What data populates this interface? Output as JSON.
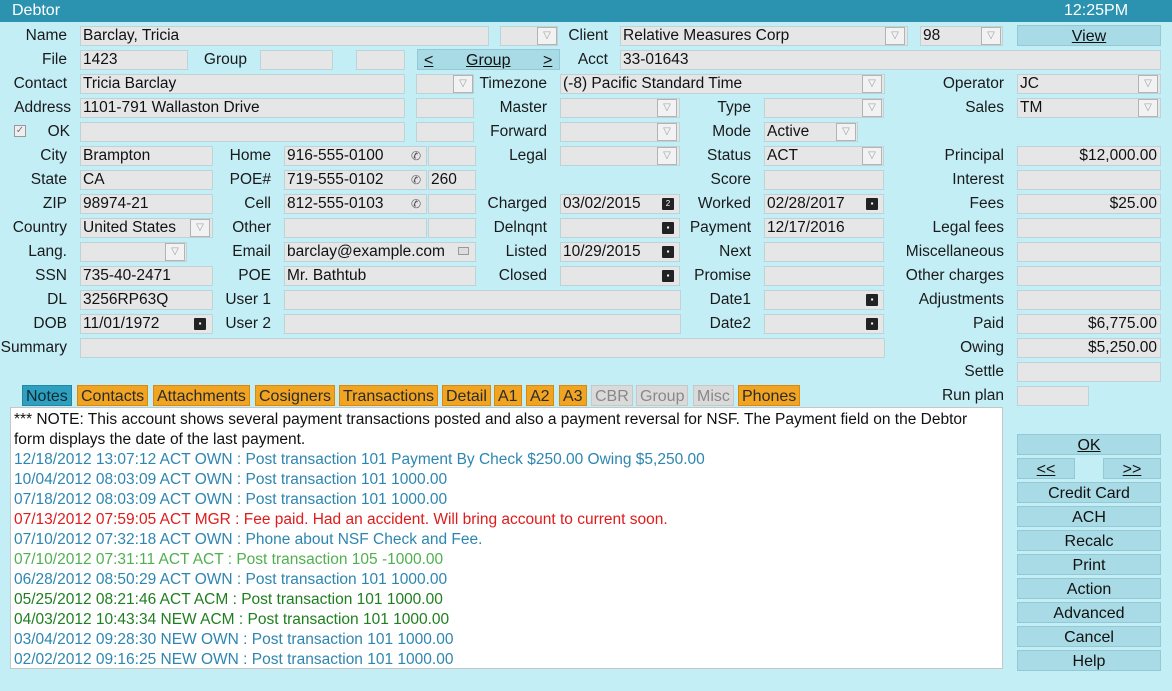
{
  "titlebar": {
    "title": "Debtor",
    "clock": "12:25PM"
  },
  "labels": {
    "name": "Name",
    "file": "File",
    "group": "Group",
    "contact": "Contact",
    "address": "Address",
    "ok": "OK",
    "city": "City",
    "state": "State",
    "zip": "ZIP",
    "country": "Country",
    "lang": "Lang.",
    "ssn": "SSN",
    "dl": "DL",
    "dob": "DOB",
    "summary": "Summary",
    "home": "Home",
    "poe_num": "POE#",
    "cell": "Cell",
    "other": "Other",
    "email": "Email",
    "poe": "POE",
    "user1": "User 1",
    "user2": "User 2",
    "client": "Client",
    "acct": "Acct",
    "timezone": "Timezone",
    "master": "Master",
    "forward": "Forward",
    "legal": "Legal",
    "charged": "Charged",
    "delnqnt": "Delnqnt",
    "listed": "Listed",
    "closed": "Closed",
    "type": "Type",
    "mode": "Mode",
    "status": "Status",
    "score": "Score",
    "worked": "Worked",
    "payment": "Payment",
    "next": "Next",
    "promise": "Promise",
    "date1": "Date1",
    "date2": "Date2",
    "operator": "Operator",
    "sales": "Sales",
    "principal": "Principal",
    "interest": "Interest",
    "fees": "Fees",
    "legal_fees": "Legal fees",
    "miscellaneous": "Miscellaneous",
    "other_charges": "Other charges",
    "adjustments": "Adjustments",
    "paid": "Paid",
    "owing": "Owing",
    "settle": "Settle",
    "run_plan": "Run plan"
  },
  "fields": {
    "name": "Barclay, Tricia",
    "file": "1423",
    "group": "",
    "contact": "Tricia Barclay",
    "address": "1101-791 Wallaston Drive",
    "city": "Brampton",
    "state": "CA",
    "zip": "98974-21",
    "country": "United States",
    "lang": "",
    "ssn": "735-40-2471",
    "dl": "3256RP63Q",
    "dob": "11/01/1972",
    "home": "916-555-0100",
    "poe_num": "719-555-0102",
    "poe_ext": "260",
    "cell": "812-555-0103",
    "other": "",
    "email": "barclay@example.com",
    "poe": "Mr. Bathtub",
    "user1": "",
    "user2": "",
    "summary": "",
    "client": "Relative Measures Corp",
    "client_code": "98",
    "acct": "33-01643",
    "timezone": "(-8) Pacific Standard Time",
    "charged": "03/02/2015",
    "listed": "10/29/2015",
    "mode": "Active",
    "status": "ACT",
    "worked": "02/28/2017",
    "payment": "12/17/2016",
    "operator": "JC",
    "sales": "TM",
    "principal": "$12,000.00",
    "fees": "$25.00",
    "paid": "$6,775.00",
    "owing": "$5,250.00"
  },
  "buttons": {
    "view": "View",
    "group_prev": "<",
    "group": "Group",
    "group_next": ">"
  },
  "tabs": [
    "Notes",
    "Contacts",
    "Attachments",
    "Cosigners",
    "Transactions",
    "Detail",
    "A1",
    "A2",
    "A3",
    "CBR",
    "Group",
    "Misc",
    "Phones"
  ],
  "notes": [
    {
      "text": "*** NOTE: This account shows several payment transactions posted and also a payment reversal for NSF. The Payment field on the Debtor",
      "color": "#111111"
    },
    {
      "text": "form displays the date of the last payment.",
      "color": "#111111"
    },
    {
      "text": "12/18/2012 13:07:12 ACT OWN : Post transaction 101 Payment By Check $250.00 Owing $5,250.00",
      "color": "#2e86b0"
    },
    {
      "text": "10/04/2012 08:03:09 ACT OWN : Post transaction 101 1000.00",
      "color": "#2e86b0"
    },
    {
      "text": "07/18/2012 08:03:09 ACT OWN : Post transaction 101 1000.00",
      "color": "#2e86b0"
    },
    {
      "text": "07/13/2012 07:59:05 ACT MGR : Fee paid. Had an accident. Will bring account to current soon.",
      "color": "#e01b1b"
    },
    {
      "text": "07/10/2012 07:32:18 ACT OWN : Phone about NSF Check and Fee.",
      "color": "#2e86b0"
    },
    {
      "text": "07/10/2012 07:31:11 ACT ACT : Post transaction 105 -1000.00",
      "color": "#4fb04f"
    },
    {
      "text": "06/28/2012 08:50:29 ACT OWN : Post transaction 101 1000.00",
      "color": "#2e86b0"
    },
    {
      "text": "05/25/2012 08:21:46 ACT ACM : Post transaction 101 1000.00",
      "color": "#1f7f1f"
    },
    {
      "text": "04/03/2012 10:43:34 NEW ACM : Post transaction 101 1000.00",
      "color": "#1f7f1f"
    },
    {
      "text": "03/04/2012 09:28:30 NEW OWN : Post transaction 101 1000.00",
      "color": "#2e86b0"
    },
    {
      "text": "02/02/2012 09:16:25 NEW OWN : Post transaction 101 1000.00",
      "color": "#2e86b0"
    }
  ],
  "side_buttons": {
    "ok": "OK",
    "prev": "<<",
    "next": ">>",
    "credit_card": "Credit Card",
    "ach": "ACH",
    "recalc": "Recalc",
    "print": "Print",
    "action": "Action",
    "advanced": "Advanced",
    "cancel": "Cancel",
    "help": "Help"
  }
}
